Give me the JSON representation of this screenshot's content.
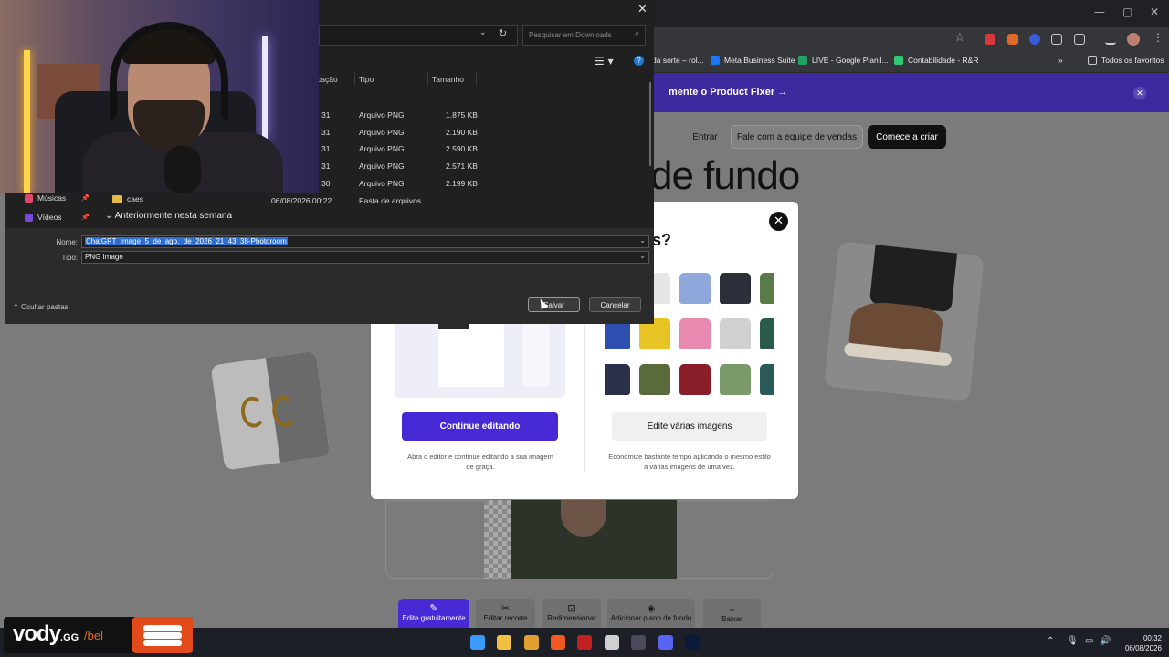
{
  "browser": {
    "bookmarks": [
      {
        "label": "da sorte – rol...",
        "color": "#8a8a8a"
      },
      {
        "label": "Meta Business Suite",
        "color": "#1877f2"
      },
      {
        "label": "LIVE - Google Planil...",
        "color": "#1fa463"
      },
      {
        "label": "Contabilidade - R&R",
        "color": "#2ecc71"
      }
    ],
    "all_favorites": "Todos os favoritos"
  },
  "page": {
    "promo_text": "mente o Product Fixer →",
    "nav": {
      "login": "Entrar",
      "sales": "Fale com a equipe de vendas",
      "start": "Comece a criar"
    },
    "hero_text": "de fundo",
    "tools": [
      {
        "icon": "✎",
        "label": "Edite gratuitamente",
        "active": true
      },
      {
        "icon": "✂",
        "label": "Editar recorte"
      },
      {
        "icon": "⊡",
        "label": "Redimensionar"
      },
      {
        "icon": "◈",
        "label": "Adicionar plano de fundo"
      },
      {
        "icon": "⤓",
        "label": "Baixar"
      }
    ]
  },
  "modal": {
    "question_fragment": "s?",
    "continue_button": "Continue editando",
    "continue_desc": "Abra o editor e continue editando a sua imagem de graça.",
    "batch_button": "Edite várias imagens",
    "batch_desc": "Economize bastante tempo aplicando o mesmo estilo a várias imagens de uma vez.",
    "tee_colors": [
      "#b8b8b8",
      "#e6e6e6",
      "#8fa8dc",
      "#2a2f3a",
      "#5a7a4a",
      "#2f4fb0",
      "#e8c324",
      "#e88ab0",
      "#d0d0d0",
      "#2a5a4a",
      "#2a2f4a",
      "#5a6a3a",
      "#8a1f2a",
      "#7a9a6a",
      "#2a5a5a"
    ]
  },
  "dialog": {
    "search_placeholder": "Pesquisar em Downloads",
    "columns": {
      "date": "cação",
      "type": "Tipo",
      "size": "Tamanho"
    },
    "files": [
      {
        "date": "31",
        "type": "Arquivo PNG",
        "size": "1.875 KB"
      },
      {
        "date": "31",
        "type": "Arquivo PNG",
        "size": "2.190 KB"
      },
      {
        "date": "31",
        "type": "Arquivo PNG",
        "size": "2.590 KB"
      },
      {
        "date": "31",
        "type": "Arquivo PNG",
        "size": "2.571 KB"
      },
      {
        "date": "30",
        "type": "Arquivo PNG",
        "size": "2.199 KB"
      }
    ],
    "folder": {
      "name": "caes",
      "date": "06/08/2026 00:22",
      "type": "Pasta de arquivos"
    },
    "group_header": "Anteriormente nesta semana",
    "sidebar": [
      {
        "label": "Músicas",
        "color": "#e04a6a"
      },
      {
        "label": "Vídeos",
        "color": "#7a4ad6"
      }
    ],
    "name_label": "Nome:",
    "name_value": "ChatGPT_Image_5_de_ago._de_2026_21_43_38-Photoroom",
    "type_label": "Tipo:",
    "type_value": "PNG Image",
    "hide_folders": "Ocultar pastas",
    "save": "Salvar",
    "cancel": "Cancelar"
  },
  "overlay": {
    "logo_main": "vody",
    "logo_gg": ".GG",
    "logo_slash": "/bel"
  },
  "taskbar": {
    "apps": [
      {
        "name": "windows-start-icon",
        "color": "#3a9bff"
      },
      {
        "name": "file-explorer-icon",
        "color": "#f0c040"
      },
      {
        "name": "chrome-icon",
        "color": "#e0a030"
      },
      {
        "name": "brave-icon",
        "color": "#f05a22"
      },
      {
        "name": "streamer-app-icon",
        "color": "#c02020"
      },
      {
        "name": "obs-icon",
        "color": "#d0d0d0"
      },
      {
        "name": "app-icon",
        "color": "#4a4a5a"
      },
      {
        "name": "discord-icon",
        "color": "#5865f2"
      },
      {
        "name": "photoshop-icon",
        "color": "#0a1a3a"
      }
    ],
    "time": "00:32",
    "date": "06/08/2026"
  }
}
